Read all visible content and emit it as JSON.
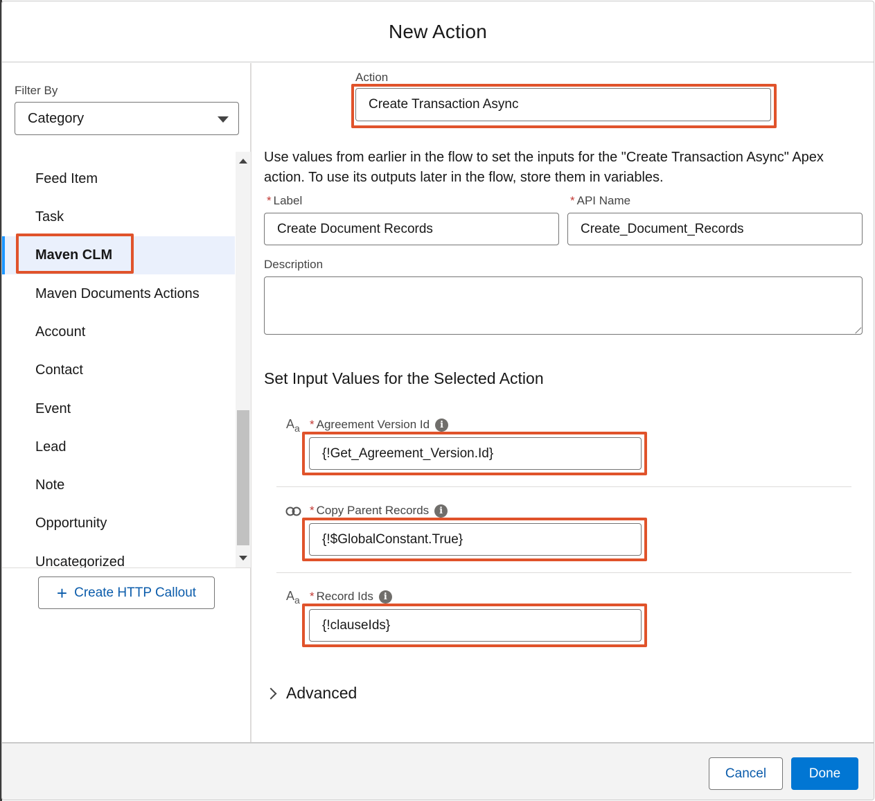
{
  "modal": {
    "title": "New Action"
  },
  "filter": {
    "label": "Filter By",
    "value": "Category"
  },
  "categories": [
    {
      "label": "Feed Item"
    },
    {
      "label": "Task"
    },
    {
      "label": "Maven CLM",
      "selected": true
    },
    {
      "label": "Maven Documents Actions"
    },
    {
      "label": "Account"
    },
    {
      "label": "Contact"
    },
    {
      "label": "Event"
    },
    {
      "label": "Lead"
    },
    {
      "label": "Note"
    },
    {
      "label": "Opportunity"
    },
    {
      "label": "Uncategorized"
    }
  ],
  "create_http_callout": {
    "label": "Create HTTP Callout"
  },
  "action": {
    "label": "Action",
    "value": "Create Transaction Async"
  },
  "help_text": "Use values from earlier in the flow to set the inputs for the \"Create Transaction Async\" Apex action. To use its outputs later in the flow, store them in variables.",
  "label_field": {
    "required_mark": "*",
    "label": "Label",
    "value": "Create Document Records"
  },
  "api_name_field": {
    "required_mark": "*",
    "label": "API Name",
    "value": "Create_Document_Records"
  },
  "description_field": {
    "label": "Description",
    "value": ""
  },
  "inputs_section": {
    "title": "Set Input Values for the Selected Action"
  },
  "inputs": [
    {
      "type_icon": "text-type-icon",
      "type_glyph": "Aa",
      "required_mark": "*",
      "label": "Agreement Version Id",
      "value": "{!Get_Agreement_Version.Id}"
    },
    {
      "type_icon": "boolean-type-icon",
      "type_glyph": "",
      "required_mark": "*",
      "label": "Copy Parent Records",
      "value": "{!$GlobalConstant.True}"
    },
    {
      "type_icon": "text-type-icon",
      "type_glyph": "Aa",
      "required_mark": "*",
      "label": "Record Ids",
      "value": "{!clauseIds}"
    }
  ],
  "advanced": {
    "label": "Advanced"
  },
  "footer": {
    "cancel_label": "Cancel",
    "done_label": "Done"
  },
  "colors": {
    "highlight": "#e0532b",
    "brand": "#0176d3",
    "link": "#0b5cab",
    "selected_bg": "#eaf0fc"
  }
}
